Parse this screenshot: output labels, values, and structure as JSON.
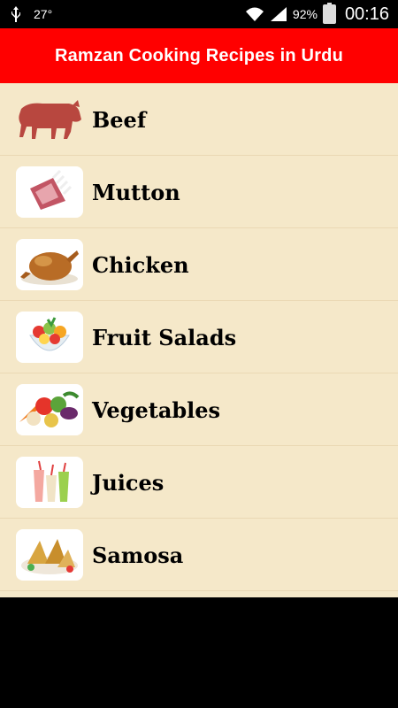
{
  "status_bar": {
    "temperature": "27°",
    "battery": "92%",
    "time": "00:16",
    "icons": [
      "usb-icon",
      "wifi-icon",
      "signal-icon",
      "battery-icon"
    ]
  },
  "header": {
    "title": "Ramzan Cooking Recipes in Urdu"
  },
  "categories": [
    {
      "label": "Beef",
      "icon": "beef-icon"
    },
    {
      "label": "Mutton",
      "icon": "mutton-icon"
    },
    {
      "label": "Chicken",
      "icon": "chicken-icon"
    },
    {
      "label": "Fruit Salads",
      "icon": "fruit-salad-icon"
    },
    {
      "label": "Vegetables",
      "icon": "vegetables-icon"
    },
    {
      "label": "Juices",
      "icon": "juices-icon"
    },
    {
      "label": "Samosa",
      "icon": "samosa-icon"
    }
  ],
  "colors": {
    "header_bg": "#ff0000",
    "list_bg": "#f5e8c9",
    "text": "#000000"
  }
}
